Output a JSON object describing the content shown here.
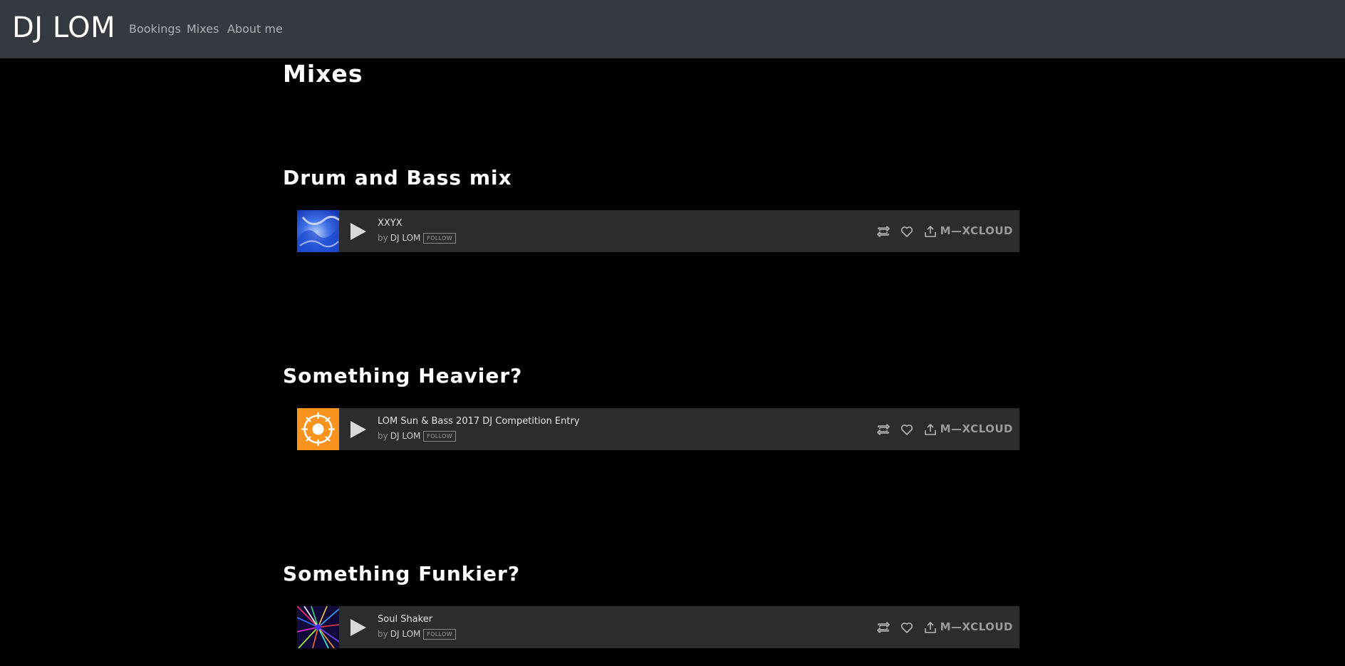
{
  "navbar": {
    "brand": "DJ LOM",
    "links": [
      "Bookings",
      "Mixes",
      "About me"
    ]
  },
  "page": {
    "title": "Mixes"
  },
  "colors": {
    "navbar_bg": "#343a40",
    "page_bg": "#000000",
    "player_bg": "#2a2c2e"
  },
  "sections": [
    {
      "heading": "Drum and Bass mix",
      "player": {
        "track": "XXYX",
        "by": "by",
        "artist": "DJ LOM",
        "follow": "FOLLOW",
        "wordmark": "M—XCLOUD",
        "artwork": "blue-abstract-artwork"
      }
    },
    {
      "heading": "Something Heavier?",
      "player": {
        "track": "LOM Sun & Bass 2017 DJ Competition Entry",
        "by": "by",
        "artist": "DJ LOM",
        "follow": "FOLLOW",
        "wordmark": "M—XCLOUD",
        "artwork": "orange-sun-artwork"
      }
    },
    {
      "heading": "Something Funkier?",
      "player": {
        "track": "Soul Shaker",
        "by": "by",
        "artist": "DJ LOM",
        "follow": "FOLLOW",
        "wordmark": "M—XCLOUD",
        "artwork": "colorful-burst-artwork"
      }
    }
  ],
  "player_icons": [
    "repost-icon",
    "heart-icon",
    "share-icon"
  ]
}
